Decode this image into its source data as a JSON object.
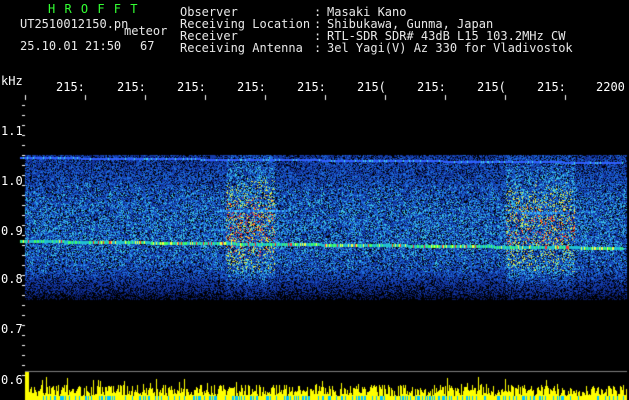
{
  "header": {
    "title": "H R O F F T",
    "filename": "UT2510012150.pn",
    "meteor_label": "meteor",
    "datetime": "25.10.01 21:50",
    "count": "67",
    "labels": [
      "Observer",
      "Receiving Location",
      "Receiver",
      "Receiving Antenna"
    ],
    "colons": [
      ":",
      ":",
      ":",
      ":"
    ],
    "values": [
      "Masaki Kano",
      "Shibukawa, Gunma, Japan",
      "RTL-SDR SDR# 43dB L15 103.2MHz CW",
      "3el Yagi(V) Az 330 for Vladivostok"
    ]
  },
  "axis": {
    "y_unit": "kHz",
    "y_ticks": [
      "1.1",
      "1.0",
      "0.9",
      "0.8",
      "0.7",
      "0.6"
    ],
    "x_ticks": [
      "215:",
      "215:",
      "215:",
      "215:",
      "215:",
      "215(",
      "215:",
      "215(",
      "215:",
      "2200"
    ]
  },
  "colors": {
    "background": "#000000",
    "header_green": "#33ff33",
    "signal_high": "#ff3030",
    "signal_mid": "#ffff40",
    "signal_low": "#1030a0",
    "histogram": "#ffff00"
  }
}
